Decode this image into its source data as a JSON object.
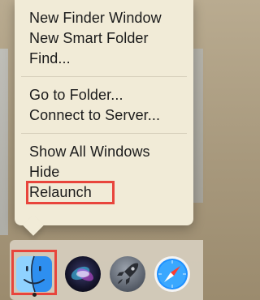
{
  "menu": {
    "groups": [
      [
        "New Finder Window",
        "New Smart Folder",
        "Find..."
      ],
      [
        "Go to Folder...",
        "Connect to Server..."
      ],
      [
        "Show All Windows",
        "Hide",
        "Relaunch"
      ]
    ]
  },
  "dock": {
    "icons": [
      "finder-icon",
      "siri-icon",
      "launchpad-icon",
      "safari-icon"
    ],
    "highlight_color": "#e8453c"
  }
}
